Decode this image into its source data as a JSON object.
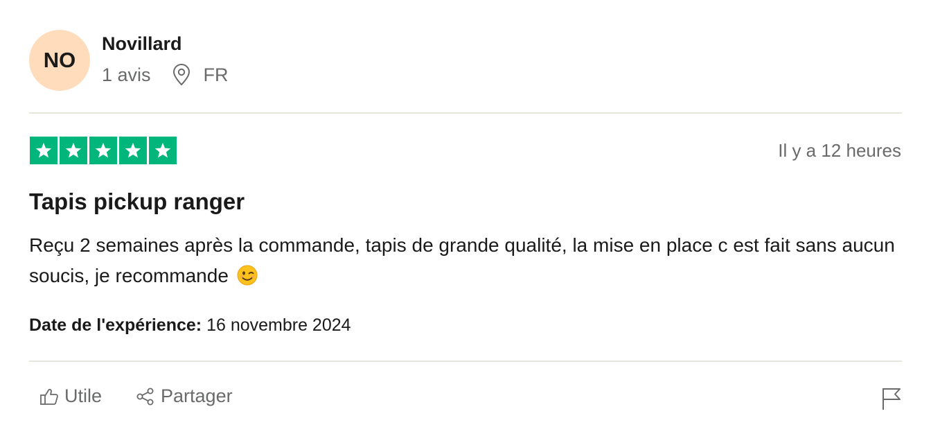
{
  "reviewer": {
    "initials": "NO",
    "avatar_color": "#ffdcbc",
    "name": "Novillard",
    "review_count": "1 avis",
    "country": "FR",
    "location_icon": "map-pin-icon"
  },
  "review": {
    "rating": 5,
    "rating_max": 5,
    "star_color": "#00b67a",
    "posted_ago": "Il y a 12 heures",
    "title": "Tapis pickup ranger",
    "body": "Reçu 2 semaines après la commande, tapis de grande qualité, la mise en place c est fait sans aucun soucis, je recommande",
    "body_emoji": "winking-face-emoji",
    "experience_label": "Date de l'expérience:",
    "experience_date": "16 novembre 2024"
  },
  "actions": {
    "useful_label": "Utile",
    "useful_icon": "thumbs-up-icon",
    "share_label": "Partager",
    "share_icon": "share-icon",
    "report_icon": "flag-icon"
  }
}
